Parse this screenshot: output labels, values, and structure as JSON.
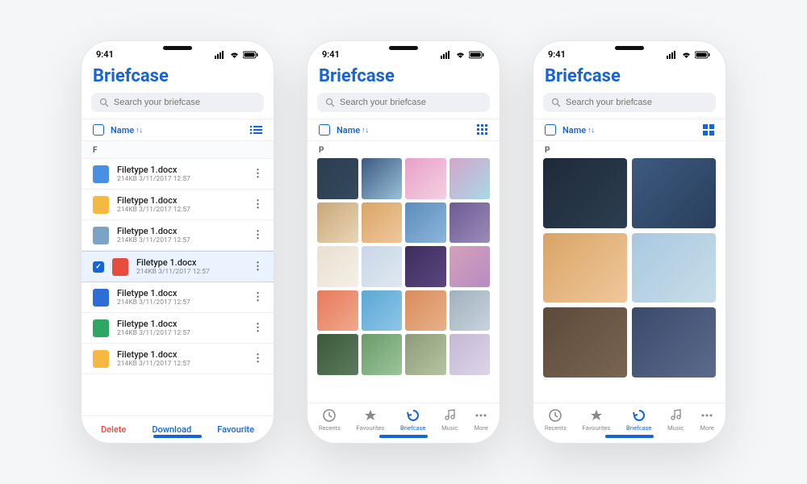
{
  "status": {
    "time": "9:41"
  },
  "app_title": "Briefcase",
  "search": {
    "placeholder": "Search your briefcase"
  },
  "sort": {
    "label": "Name",
    "arrows": "↑↓"
  },
  "list_view": {
    "section": "F",
    "files": [
      {
        "name": "Filetype 1.docx",
        "meta": "214KB  3/11/2017  12:57",
        "icon": "doc"
      },
      {
        "name": "Filetype 1.docx",
        "meta": "214KB  3/11/2017  12:57",
        "icon": "folder"
      },
      {
        "name": "Filetype 1.docx",
        "meta": "214KB  3/11/2017  12:57",
        "icon": "print"
      },
      {
        "name": "Filetype 1.docx",
        "meta": "214KB  3/11/2017  12:57",
        "icon": "pdf",
        "selected": true
      },
      {
        "name": "Filetype 1.docx",
        "meta": "214KB  3/11/2017  12:57",
        "icon": "docx"
      },
      {
        "name": "Filetype 1.docx",
        "meta": "214KB  3/11/2017  12:57",
        "icon": "xls"
      },
      {
        "name": "Filetype 1.docx",
        "meta": "214KB  3/11/2017  12:57",
        "icon": "folder"
      }
    ],
    "actions": {
      "delete": "Delete",
      "download": "Download",
      "favourite": "Favourite"
    }
  },
  "grid_view": {
    "section": "P"
  },
  "tabs": {
    "recents": "Recents",
    "favourites": "Favourites",
    "briefcase": "Briefcase",
    "music": "Music",
    "more": "More"
  },
  "thumb_colors_4": [
    "linear-gradient(135deg,#2c3e50,#34495e)",
    "linear-gradient(135deg,#3d5a80,#98c1d9)",
    "linear-gradient(135deg,#e8a0c8,#f4d0e0)",
    "linear-gradient(135deg,#d4a5c9,#a8d8e8)",
    "linear-gradient(135deg,#c9a87a,#e8d5b5)",
    "linear-gradient(135deg,#d9a566,#f0c79b)",
    "linear-gradient(135deg,#5b8dbd,#8eb5d9)",
    "linear-gradient(135deg,#6b5b95,#9b8cb8)",
    "linear-gradient(135deg,#e8e0d0,#f5efe5)",
    "linear-gradient(135deg,#c9d6e8,#e0e8f0)",
    "linear-gradient(135deg,#3d2e5c,#5a4680)",
    "linear-gradient(135deg,#d4a0b8,#b88cc4)",
    "linear-gradient(135deg,#e87a5c,#f0a88c)",
    "linear-gradient(135deg,#5ba8d4,#8ec5e8)",
    "linear-gradient(135deg,#d98c5c,#e8b088)",
    "linear-gradient(135deg,#a0b0bd,#c8d4dd)",
    "linear-gradient(135deg,#3a5a3a,#5c7a5c)",
    "linear-gradient(135deg,#6b9b6b,#9bc49b)",
    "linear-gradient(135deg,#8e9b7a,#b5c4a0)",
    "linear-gradient(135deg,#c4b8d4,#ddd4e8)"
  ],
  "thumb_colors_2": [
    "linear-gradient(135deg,#1e2a3a,#2c3e50)",
    "linear-gradient(135deg,#3d5a80,#293f5c)",
    "linear-gradient(135deg,#d9a566,#f0c79b)",
    "linear-gradient(135deg,#a8c8e0,#c8dde8)",
    "linear-gradient(135deg,#5c4a3a,#7a6552)",
    "linear-gradient(135deg,#3a4a6b,#5c6b8c)"
  ]
}
